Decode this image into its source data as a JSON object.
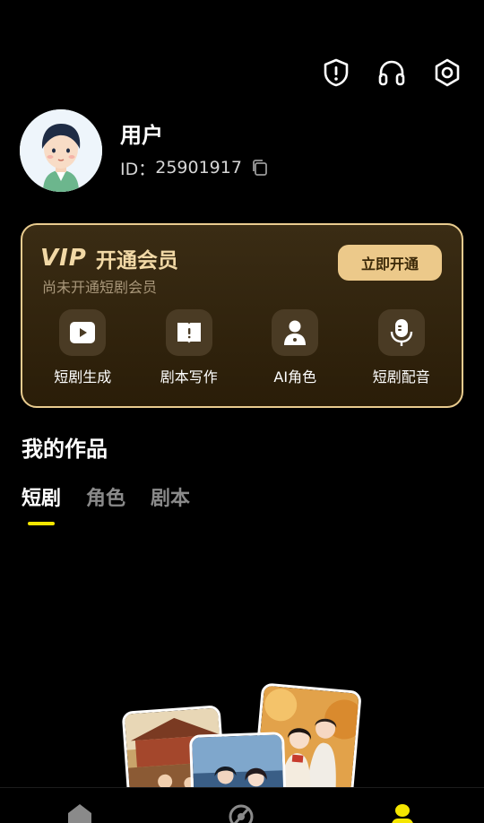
{
  "header": {
    "icons": [
      "shield-alert-icon",
      "headset-icon",
      "settings-hex-icon"
    ]
  },
  "profile": {
    "username": "用户",
    "id_label": "ID：",
    "id_value": "25901917"
  },
  "vip": {
    "logo": "VIP",
    "title": "开通会员",
    "subtitle": "尚未开通短剧会员",
    "button_label": "立即开通",
    "features": [
      {
        "label": "短剧生成",
        "icon": "video-play-icon"
      },
      {
        "label": "剧本写作",
        "icon": "book-icon"
      },
      {
        "label": "AI角色",
        "icon": "person-icon"
      },
      {
        "label": "短剧配音",
        "icon": "microphone-icon"
      }
    ]
  },
  "works": {
    "title": "我的作品",
    "tabs": [
      {
        "label": "短剧",
        "active": true
      },
      {
        "label": "角色",
        "active": false
      },
      {
        "label": "剧本",
        "active": false
      }
    ]
  },
  "bottom_nav": {
    "items": [
      {
        "icon": "home-icon",
        "active": false
      },
      {
        "icon": "explore-icon",
        "active": false
      },
      {
        "icon": "profile-icon",
        "active": true
      }
    ]
  },
  "colors": {
    "accent_gold": "#ecc98a",
    "active_yellow": "#f5e600",
    "background": "#000000"
  }
}
